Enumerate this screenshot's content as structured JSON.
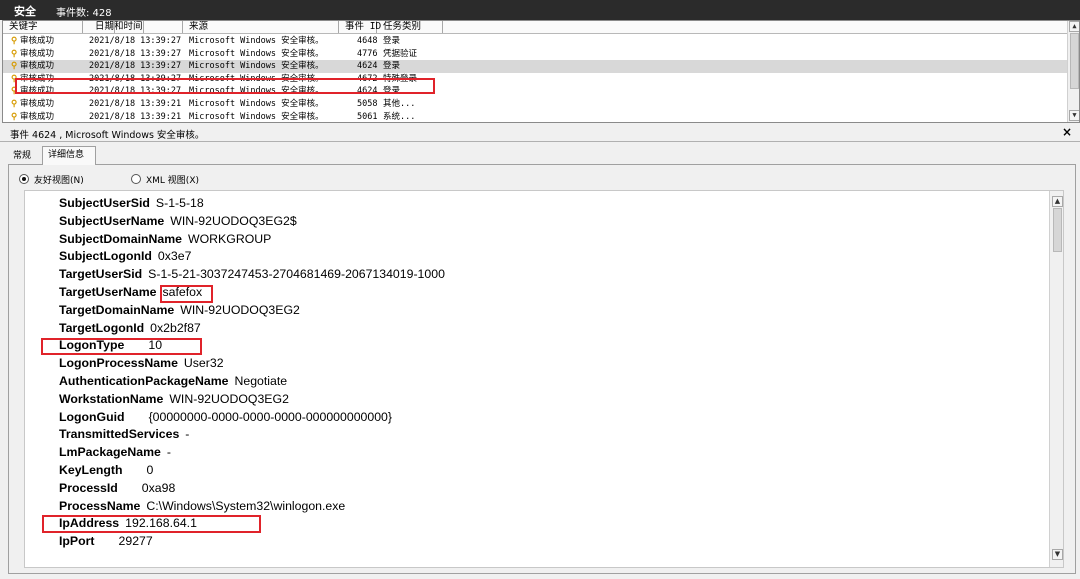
{
  "window": {
    "title": "安全",
    "event_count": "事件数: 428"
  },
  "list": {
    "columns": {
      "keyword": "关键字",
      "datetime": "日期和时间",
      "source": "来源",
      "event_id": "事件 ID",
      "category": "任务类别"
    },
    "rows": [
      {
        "keyword": "审核成功",
        "datetime": "2021/8/18 13:39:27",
        "source": "Microsoft Windows 安全审核。",
        "event_id": "4648",
        "category": "登录"
      },
      {
        "keyword": "审核成功",
        "datetime": "2021/8/18 13:39:27",
        "source": "Microsoft Windows 安全审核。",
        "event_id": "4776",
        "category": "凭据验证"
      },
      {
        "keyword": "审核成功",
        "datetime": "2021/8/18 13:39:27",
        "source": "Microsoft Windows 安全审核。",
        "event_id": "4624",
        "category": "登录"
      },
      {
        "keyword": "审核成功",
        "datetime": "2021/8/18 13:39:27",
        "source": "Microsoft Windows 安全审核。",
        "event_id": "4672",
        "category": "特殊登录"
      },
      {
        "keyword": "审核成功",
        "datetime": "2021/8/18 13:39:27",
        "source": "Microsoft Windows 安全审核。",
        "event_id": "4624",
        "category": "登录"
      },
      {
        "keyword": "审核成功",
        "datetime": "2021/8/18 13:39:21",
        "source": "Microsoft Windows 安全审核。",
        "event_id": "5058",
        "category": "其他..."
      },
      {
        "keyword": "审核成功",
        "datetime": "2021/8/18 13:39:21",
        "source": "Microsoft Windows 安全审核。",
        "event_id": "5061",
        "category": "系统..."
      }
    ]
  },
  "detail": {
    "header": "事件 4624 , Microsoft Windows 安全审核。",
    "close": "×",
    "tabs": {
      "general": "常规",
      "details": "详细信息"
    },
    "radios": {
      "friendly": "友好视图(N)",
      "xml": "XML 视图(X)"
    },
    "fields": [
      {
        "key": "SubjectUserSid",
        "value": "S-1-5-18"
      },
      {
        "key": "SubjectUserName",
        "value": "WIN-92UODOQ3EG2$"
      },
      {
        "key": "SubjectDomainName",
        "value": "WORKGROUP"
      },
      {
        "key": "SubjectLogonId",
        "value": "0x3e7"
      },
      {
        "key": "TargetUserSid",
        "value": "S-1-5-21-3037247453-2704681469-2067134019-1000"
      },
      {
        "key": "TargetUserName",
        "value": "safefox"
      },
      {
        "key": "TargetDomainName",
        "value": "WIN-92UODOQ3EG2"
      },
      {
        "key": "TargetLogonId",
        "value": "0x2b2f87"
      },
      {
        "key": "LogonType",
        "value": "10"
      },
      {
        "key": "LogonProcessName",
        "value": "User32"
      },
      {
        "key": "AuthenticationPackageName",
        "value": "Negotiate"
      },
      {
        "key": "WorkstationName",
        "value": "WIN-92UODOQ3EG2"
      },
      {
        "key": "LogonGuid",
        "value": "{00000000-0000-0000-0000-000000000000}"
      },
      {
        "key": "TransmittedServices",
        "value": "-"
      },
      {
        "key": "LmPackageName",
        "value": "-"
      },
      {
        "key": "KeyLength",
        "value": "0"
      },
      {
        "key": "ProcessId",
        "value": "0xa98"
      },
      {
        "key": "ProcessName",
        "value": "C:\\Windows\\System32\\winlogon.exe"
      },
      {
        "key": "IpAddress",
        "value": "192.168.64.1"
      },
      {
        "key": "IpPort",
        "value": "29277"
      }
    ]
  },
  "colors": {
    "highlight": "#e0232a",
    "key_icon": "#d69a00",
    "topbar": "#2b2b2b"
  }
}
